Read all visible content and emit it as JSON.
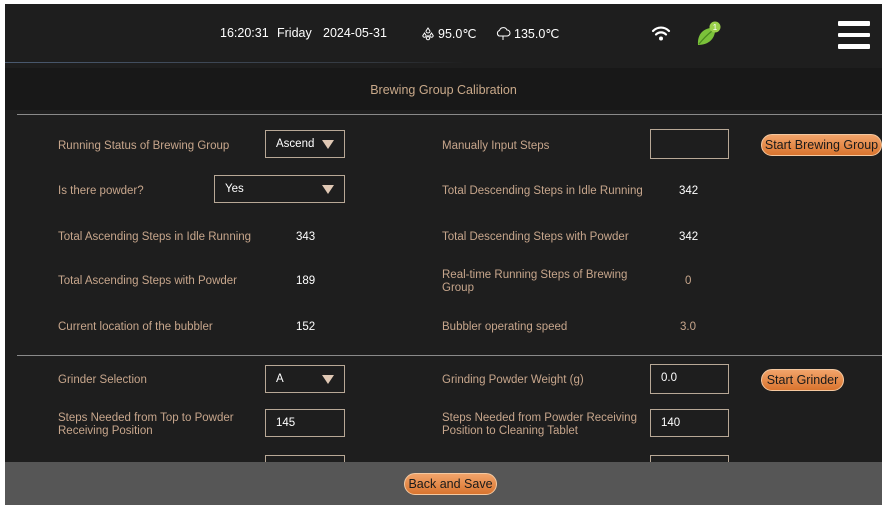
{
  "status_bar": {
    "time": "16:20:31",
    "day": "Friday",
    "date": "2024-05-31",
    "temp1": "95.0℃",
    "temp2": "135.0℃",
    "notification_count": "1"
  },
  "title": "Brewing Group Calibration",
  "brewing": {
    "running_status_label": "Running Status of Brewing Group",
    "running_status_value": "Ascend",
    "powder_label": "Is there powder?",
    "powder_value": "Yes",
    "asc_idle_label": "Total Ascending Steps in Idle Running",
    "asc_idle_value": "343",
    "asc_powder_label": "Total Ascending Steps with Powder",
    "asc_powder_value": "189",
    "bubbler_location_label": "Current location of the bubbler",
    "bubbler_location_value": "152",
    "manual_steps_label": "Manually Input Steps",
    "manual_steps_value": "",
    "start_brewing_label": "Start Brewing Group",
    "desc_idle_label": "Total Descending Steps in Idle Running",
    "desc_idle_value": "342",
    "desc_powder_label": "Total Descending Steps with Powder",
    "desc_powder_value": "342",
    "realtime_label": "Real-time Running Steps of Brewing Group",
    "realtime_value": "0",
    "bubbler_speed_label": "Bubbler operating speed",
    "bubbler_speed_value": "3.0"
  },
  "grinder": {
    "selection_label": "Grinder Selection",
    "selection_value": "A",
    "weight_label": "Grinding Powder Weight (g)",
    "weight_value": "0.0",
    "start_grinder_label": "Start Grinder",
    "top_to_powder_label": "Steps Needed from Top to Powder Receiving Position",
    "top_to_powder_value": "145",
    "powder_to_cleaning_label": "Steps Needed from Powder Receiving Position to Cleaning Tablet",
    "powder_to_cleaning_value": "140"
  },
  "footer": {
    "back_save_label": "Back and Save"
  },
  "colors": {
    "background": "#1e1e1e",
    "label": "#c7a68c",
    "button": "#e58a46",
    "footer": "#565656"
  }
}
